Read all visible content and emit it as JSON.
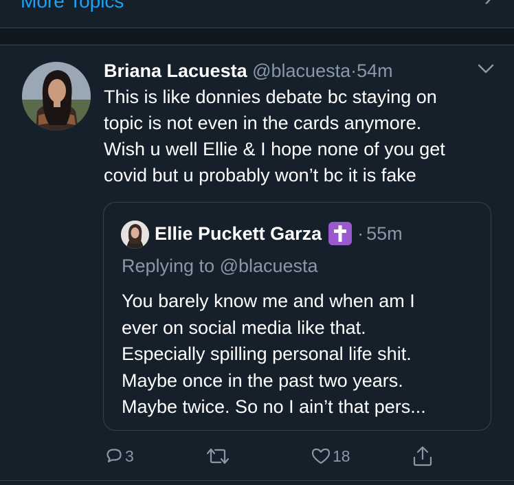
{
  "top": {
    "more_topics_label": "More Topics"
  },
  "tweet": {
    "author_name": "Briana Lacuesta",
    "author_handle": "@blacuesta",
    "separator": "·",
    "timestamp": "54m",
    "text": "This is like donnies debate bc staying on\ntopic is not even in the cards anymore.\nWish u well Ellie & I hope none of you get\ncovid but u probably won’t bc it is fake",
    "quote": {
      "author_name": "Ellie Puckett Garza",
      "badge_icon": "latin-cross-emoji",
      "separator": "·",
      "timestamp": "55m",
      "replying_to": "Replying to @blacuesta",
      "text": "You barely know me and when am I\never on social media like that.\nEspecially spilling personal life shit.\nMaybe once in the past two years.\nMaybe twice. So no I ain’t that pers..."
    },
    "actions": {
      "reply_count": "3",
      "retweet_count": "",
      "like_count": "18",
      "share_count": ""
    }
  },
  "colors": {
    "background": "#15202b",
    "text_primary": "#ffffff",
    "text_secondary": "#8899a6",
    "border": "#38444d",
    "badge": "#9b59d0"
  }
}
